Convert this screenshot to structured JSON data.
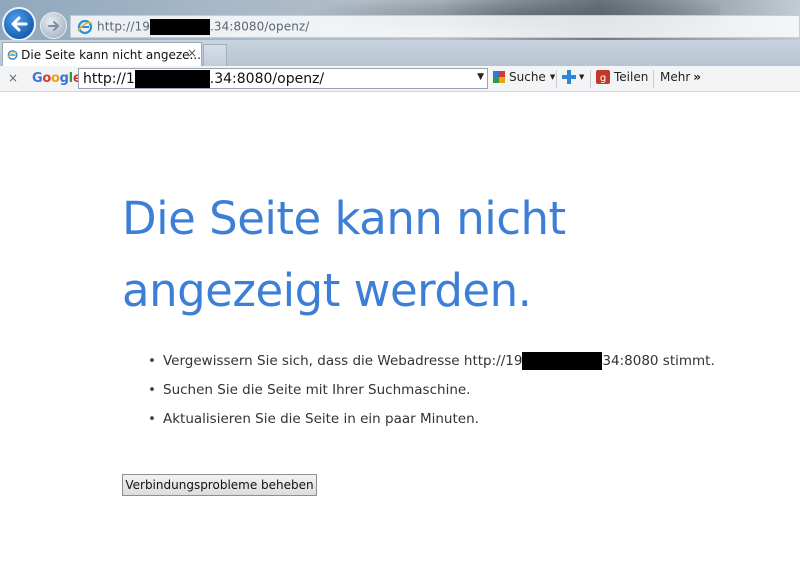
{
  "address_bar": {
    "url_prefix": "http://19",
    "url_suffix": ".34:8080/openz/"
  },
  "tab": {
    "title": "Die Seite kann nicht angeze...",
    "close": "×"
  },
  "google_toolbar": {
    "close": "×",
    "logo": "Google",
    "search_prefix": "http://1",
    "search_suffix": ".34:8080/openz/",
    "search_label": "Suche",
    "share_label": "Teilen",
    "more_label": "Mehr",
    "more_chevron": "»"
  },
  "page": {
    "headline": "Die Seite kann nicht angezeigt werden.",
    "bullets": {
      "b1_prefix": "Vergewissern Sie sich, dass die Webadresse http://19",
      "b1_suffix": "34:8080 stimmt.",
      "b2": "Suchen Sie die Seite mit Ihrer Suchmaschine.",
      "b3": "Aktualisieren Sie die Seite in ein paar Minuten."
    },
    "fix_button": "Verbindungsprobleme beheben"
  },
  "icons": {
    "back": "back-arrow-icon",
    "forward": "forward-arrow-icon",
    "ie": "internet-explorer-icon",
    "search": "google-search-icon",
    "plus": "google-plus-icon",
    "share": "share-icon"
  },
  "colors": {
    "headline": "#3d7fd6",
    "back_button": "#1a5fb4"
  }
}
